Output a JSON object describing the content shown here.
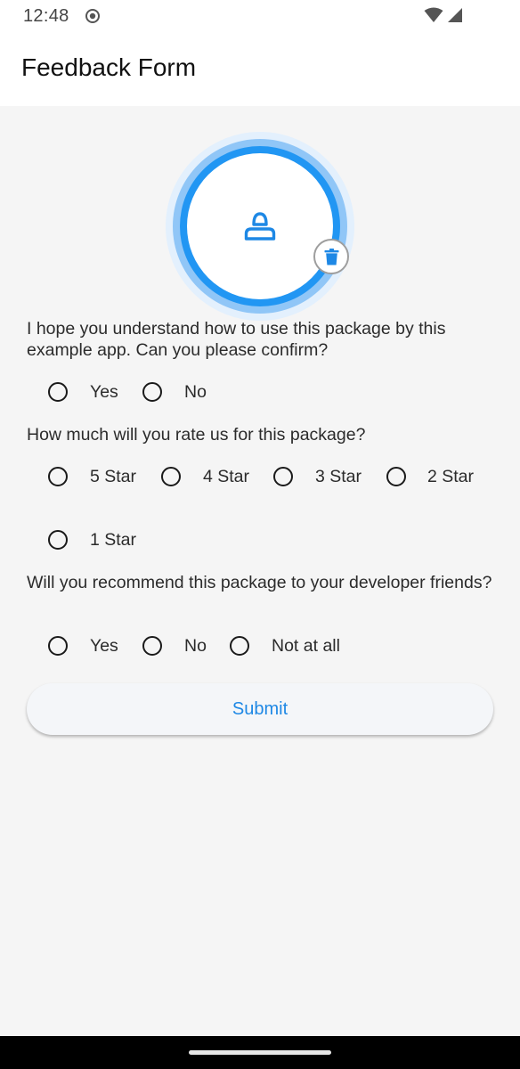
{
  "status_bar": {
    "time": "12:48",
    "icons": [
      "screen-record-icon",
      "wifi-icon",
      "cell-signal-icon"
    ]
  },
  "app_bar": {
    "title": "Feedback Form"
  },
  "avatar": {
    "icon": "person-icon",
    "delete_icon": "trash-icon",
    "accent_color": "#2196f3"
  },
  "form": {
    "questions": [
      {
        "text": "I hope you understand how to use this package by this example app. Can you please confirm?",
        "options": [
          "Yes",
          "No"
        ]
      },
      {
        "text": "How much will you rate us for this package?",
        "options": [
          "5 Star",
          "4 Star",
          "3 Star",
          "2 Star",
          "1 Star"
        ]
      },
      {
        "text": "Will you recommend this package to your developer friends?",
        "options": [
          "Yes",
          "No",
          "Not at all"
        ]
      }
    ],
    "submit_label": "Submit"
  },
  "colors": {
    "accent": "#1e88e5",
    "background": "#f5f5f5",
    "app_bar": "#ffffff"
  }
}
